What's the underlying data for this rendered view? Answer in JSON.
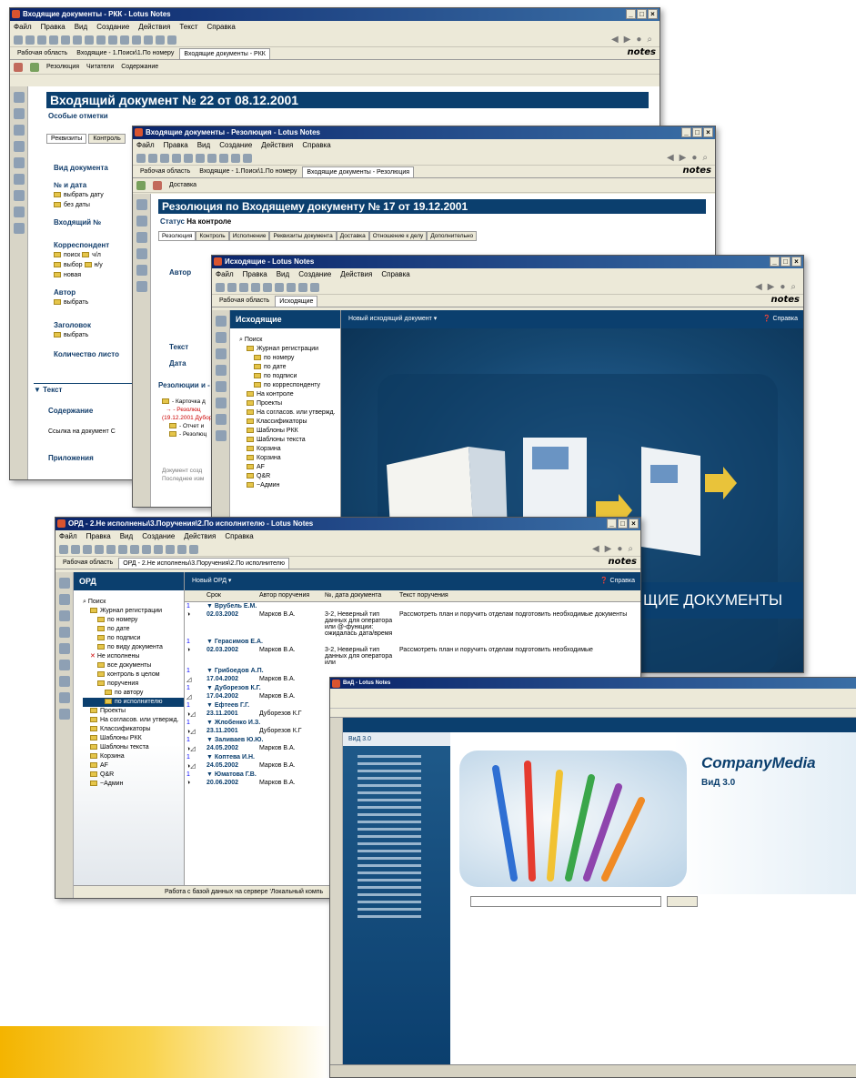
{
  "w1": {
    "title": "Входящие документы - РКК - Lotus Notes",
    "menu": [
      "Файл",
      "Правка",
      "Вид",
      "Создание",
      "Действия",
      "Текст",
      "Справка"
    ],
    "tabs": [
      "Рабочая область",
      "Входящие - 1.Поиск\\1.По номеру",
      "Входящие документы - РКК"
    ],
    "brand": "notes",
    "actions": [
      "Резолюция",
      "Читатели",
      "Содержание"
    ],
    "doc_title": "Входящий документ № 22 от 08.12.2001",
    "special_marks": "Особые отметки",
    "subtabs": [
      "Реквизиты",
      "Контроль"
    ],
    "fields": {
      "doc_type": "Вид документа",
      "num_date": "№ и дата",
      "pick_date": "выбрать дату",
      "no_date": "без даты",
      "incoming_no": "Входящий №",
      "correspondent": "Корреспондент",
      "search": "поиск",
      "chl": "ч/л",
      "choose": "выбор",
      "nu": "н/у",
      "new": "новая",
      "author": "Автор",
      "author_choose": "выбрать",
      "header": "Заголовок",
      "header_choose": "выбрать",
      "sheets": "Количество листо",
      "text": "Текст",
      "contents": "Содержание",
      "link": "Ссылка на документ С",
      "attachments": "Приложения"
    }
  },
  "w2": {
    "title": "Входящие документы - Резолюция - Lotus Notes",
    "menu": [
      "Файл",
      "Правка",
      "Вид",
      "Создание",
      "Действия",
      "Справка"
    ],
    "tabs": [
      "Рабочая область",
      "Входящие - 1.Поиск\\1.По номеру",
      "Входящие документы - Резолюция"
    ],
    "brand": "notes",
    "actions": [
      "Доставка"
    ],
    "doc_title": "Резолюция по Входящему документу № 17 от 19.12.2001",
    "status_label": "Статус",
    "status_value": "На контроле",
    "subtabs": [
      "Резолюция",
      "Контроль",
      "Исполнение",
      "Реквизиты документа",
      "Доставка",
      "Отношение к делу",
      "Дополнительно"
    ],
    "author": "Автор",
    "text": "Текст",
    "date": "Дата",
    "resolutions": "Резолюции и -",
    "tree": [
      "- Карточка д",
      "- Резолюц",
      "(19.12.2001 Дубор",
      "- Отчет и",
      "- Резолюц"
    ],
    "footer1": "Документ созд",
    "footer2": "Последнее изм"
  },
  "w3": {
    "title": "Исходящие - Lotus Notes",
    "menu": [
      "Файл",
      "Правка",
      "Вид",
      "Создание",
      "Действия",
      "Справка"
    ],
    "tabs": [
      "Рабочая область",
      "Исходящие"
    ],
    "brand": "notes",
    "nav_header": "Исходящие",
    "new_doc": "Новый исходящий документ",
    "help": "Справка",
    "nav": [
      "Поиск",
      "Журнал регистрации",
      "по номеру",
      "по дате",
      "по подписи",
      "по корреспонденту",
      "На контроле",
      "Проекты",
      "На согласов. или утвержд.",
      "Классификаторы",
      "Шаблоны РКК",
      "Шаблоны текста",
      "Корзина",
      "Корзина",
      "AF",
      "Q&R",
      "~Админ"
    ],
    "banner": "ЩИЕ ДОКУМЕНТЫ"
  },
  "w4": {
    "title": "ОРД - 2.Не исполнены\\3.Поручения\\2.По исполнителю - Lotus Notes",
    "menu": [
      "Файл",
      "Правка",
      "Вид",
      "Создание",
      "Действия",
      "Справка"
    ],
    "tabs": [
      "Рабочая область",
      "ОРД - 2.Не исполнены\\3.Поручения\\2.По исполнителю"
    ],
    "brand": "notes",
    "nav_header": "ОРД",
    "new_doc": "Новый ОРД",
    "help": "Справка",
    "nav": [
      "Поиск",
      "Журнал регистрации",
      "по номеру",
      "по дате",
      "по подписи",
      "по виду документа",
      "Не исполнены",
      "все документы",
      "контроль в целом",
      "поручения",
      "по автору",
      "по исполнителю",
      "Проекты",
      "На согласов. или утвержд.",
      "Классификаторы",
      "Шаблоны РКК",
      "Шаблоны текста",
      "Корзина",
      "AF",
      "Q&R",
      "~Админ"
    ],
    "columns": [
      "Срок",
      "Автор поручения",
      "№, дата документа",
      "Текст поручения"
    ],
    "groups": [
      {
        "name": "Врубель Е.М.",
        "date": "02.03.2002",
        "author": "Марков В.А.",
        "doc": "3-2, Неверный тип данных для оператора или @-функции: ожидалась дата/время",
        "text": "Рассмотреть план и поручить отделам подготовить необходимые документы"
      },
      {
        "name": "Герасимов Е.А.",
        "date": "02.03.2002",
        "author": "Марков В.А.",
        "doc": "3-2, Неверный тип данных для оператора или",
        "text": "Рассмотреть план и поручить отделам подготовить необходимые"
      },
      {
        "name": "Грибоедов А.П.",
        "date": "17.04.2002",
        "author": "Марков В.А.",
        "doc": "",
        "text": ""
      },
      {
        "name": "Дуборезов К.Г.",
        "date": "17.04.2002",
        "author": "Марков В.А.",
        "doc": "",
        "text": ""
      },
      {
        "name": "Ефтеев Г.Г.",
        "date": "23.11.2001",
        "author": "Дуборезов К.Г",
        "doc": "",
        "text": ""
      },
      {
        "name": "Жлобенко И.З.",
        "date": "23.11.2001",
        "author": "Дуборезов К.Г",
        "doc": "",
        "text": ""
      },
      {
        "name": "Заливаев Ю.Ю.",
        "date": "24.05.2002",
        "author": "Марков В.А.",
        "doc": "",
        "text": ""
      },
      {
        "name": "Коптева И.Н.",
        "date": "24.05.2002",
        "author": "Марков В.А.",
        "doc": "",
        "text": ""
      },
      {
        "name": "Юматова Г.В.",
        "date": "20.06.2002",
        "author": "Марков В.А.",
        "doc": "",
        "text": ""
      }
    ],
    "status": "Работа с базой данных на сервере 'Локальный компь"
  },
  "w5": {
    "title": "ВиД - Lotus Notes",
    "logo": "CompanyMedia",
    "version": "ВиД 3.0",
    "nav_tab": "ВиД 3.0"
  }
}
